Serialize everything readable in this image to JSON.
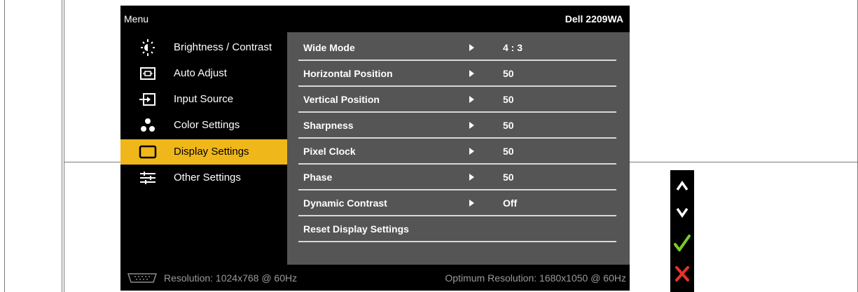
{
  "osd": {
    "title": "Menu",
    "model": "Dell 2209WA",
    "menu_items": [
      {
        "label": "Brightness / Contrast",
        "icon": "brightness-icon"
      },
      {
        "label": "Auto Adjust",
        "icon": "auto-adjust-icon"
      },
      {
        "label": "Input Source",
        "icon": "input-source-icon"
      },
      {
        "label": "Color Settings",
        "icon": "color-settings-icon"
      },
      {
        "label": "Display Settings",
        "icon": "display-settings-icon",
        "selected": true
      },
      {
        "label": "Other Settings",
        "icon": "other-settings-icon"
      }
    ],
    "settings": [
      {
        "label": "Wide Mode",
        "value": "4 : 3"
      },
      {
        "label": "Horizontal Position",
        "value": "50"
      },
      {
        "label": "Vertical Position",
        "value": "50"
      },
      {
        "label": "Sharpness",
        "value": "50"
      },
      {
        "label": "Pixel Clock",
        "value": "50"
      },
      {
        "label": "Phase",
        "value": "50"
      },
      {
        "label": "Dynamic Contrast",
        "value": "Off"
      },
      {
        "label": "Reset Display Settings",
        "value": ""
      }
    ],
    "footer": {
      "resolution": "Resolution: 1024x768 @ 60Hz",
      "optimum": "Optimum Resolution: 1680x1050 @ 60Hz",
      "icon": "vga-connector-icon"
    }
  },
  "nav_buttons": [
    {
      "name": "up-arrow-icon",
      "color": "#ffffff"
    },
    {
      "name": "down-arrow-icon",
      "color": "#ffffff"
    },
    {
      "name": "checkmark-icon",
      "color": "#7ccc2a"
    },
    {
      "name": "close-icon",
      "color": "#e8332a"
    }
  ],
  "colors": {
    "selected_bg": "#f0b71a",
    "panel_bg": "#555555",
    "osd_bg": "#000000"
  }
}
